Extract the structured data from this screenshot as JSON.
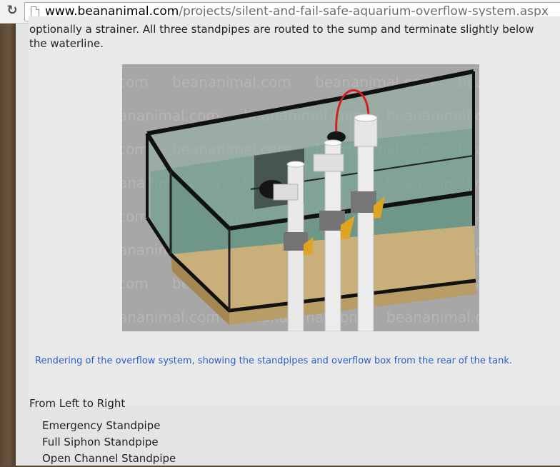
{
  "browser": {
    "url_domain": "www.beananimal.com",
    "url_path": "/projects/silent-and-fail-safe-aquarium-overflow-system.aspx",
    "reload_icon": "reload-icon",
    "page_icon": "page-icon"
  },
  "article": {
    "paragraph_text": "optionally a strainer. All three standpipes are routed to the sump and terminate slightly below the waterline.",
    "figure": {
      "watermark": "beananimal.com",
      "caption": "Rendering of the overflow system, showing the standpipes and overflow box from the rear of the tank."
    },
    "section_heading": "From Left to Right",
    "standpipes": [
      "Emergency Standpipe",
      "Full Siphon Standpipe",
      "Open Channel Standpipe"
    ]
  },
  "colors": {
    "link": "#2a61c9",
    "text": "#222222",
    "page_background": "#e4e4e4",
    "left_bar": "#5c4a36"
  }
}
